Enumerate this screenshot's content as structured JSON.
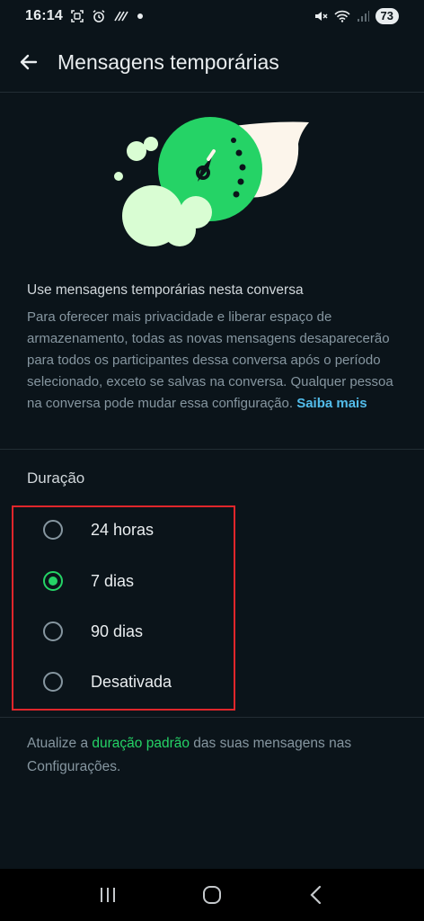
{
  "status_bar": {
    "time": "16:14",
    "battery": "73",
    "left_icons": [
      "screenshot-icon",
      "alarm-icon",
      "nfc-icon",
      "dot-icon"
    ],
    "right_icons": [
      "mute-icon",
      "wifi-icon",
      "signal-icon"
    ]
  },
  "app_bar": {
    "title": "Mensagens temporárias",
    "back_icon": "arrow-left-icon"
  },
  "description": {
    "title": "Use mensagens temporárias nesta conversa",
    "body": "Para oferecer mais privacidade e liberar espaço de armazenamento, todas as novas mensagens desaparecerão para todos os participantes dessa conversa após o período selecionado, exceto se salvas na conversa. Qualquer pessoa na conversa pode mudar essa configuração.",
    "learn_more": "Saiba mais"
  },
  "duration": {
    "label": "Duração",
    "selected": "7 dias",
    "options": [
      {
        "label": "24 horas",
        "selected": false
      },
      {
        "label": "7 dias",
        "selected": true
      },
      {
        "label": "90 dias",
        "selected": false
      },
      {
        "label": "Desativada",
        "selected": false
      }
    ]
  },
  "footer": {
    "prefix": "Atualize a ",
    "link": "duração padrão",
    "suffix": " das suas mensagens nas Configurações."
  },
  "nav_bar": {
    "icons": [
      "recents-icon",
      "home-icon",
      "back-icon"
    ]
  },
  "colors": {
    "background": "#0b141a",
    "accent_green": "#25d366",
    "link_blue": "#53bdeb",
    "highlight_red": "#e0262b"
  }
}
